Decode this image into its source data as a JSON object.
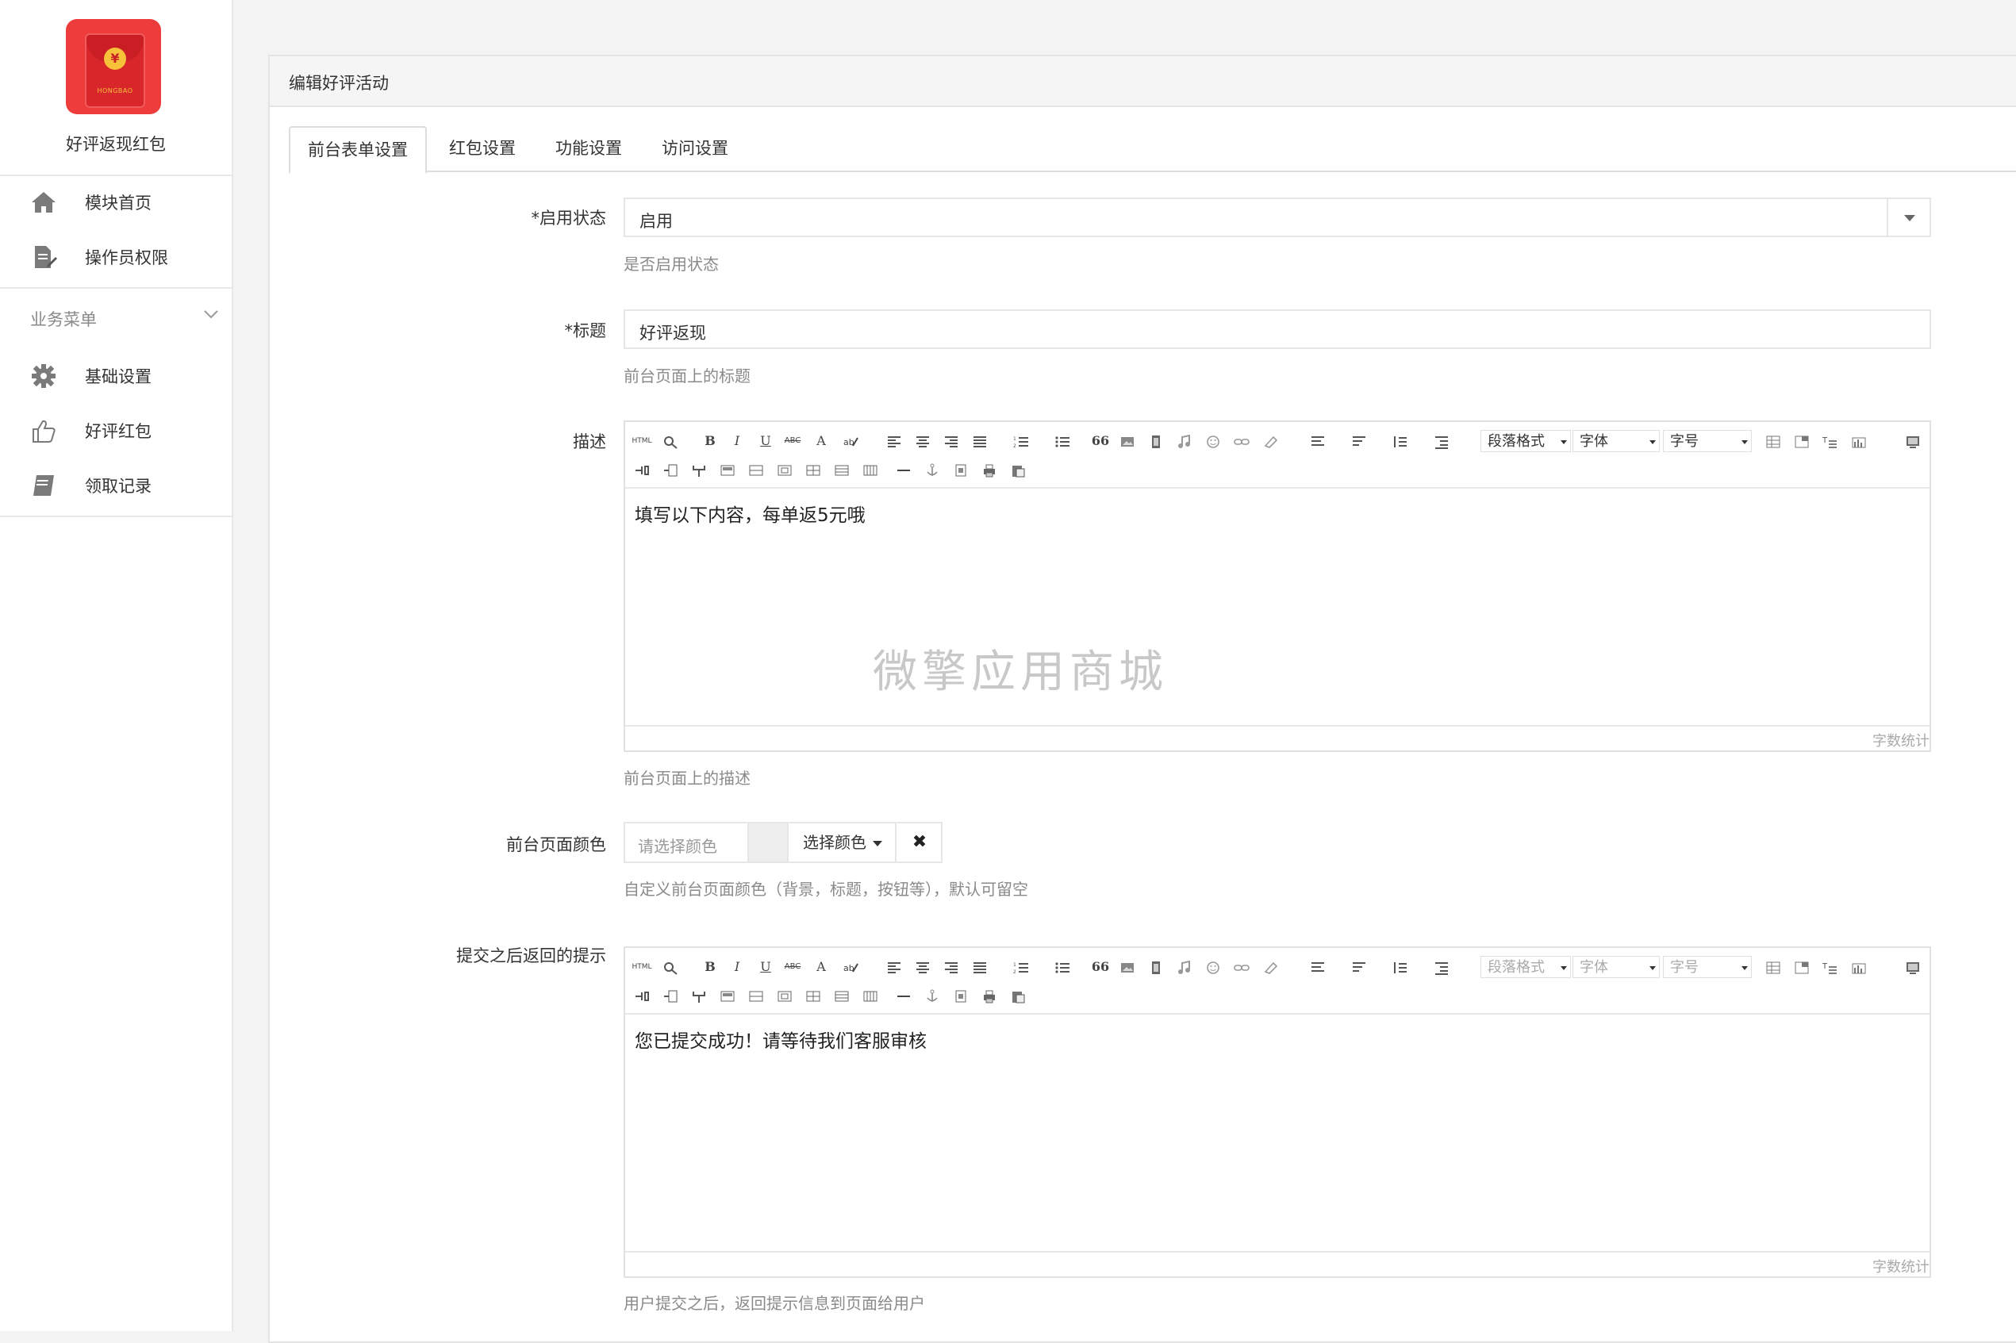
{
  "sidebar": {
    "app_name": "好评返现红包",
    "logo_text": "HONGBAO",
    "logo_symbol": "¥",
    "top_items": [
      {
        "label": "模块首页",
        "icon": "home-icon"
      },
      {
        "label": "操作员权限",
        "icon": "document-edit-icon"
      }
    ],
    "group_title": "业务菜单",
    "group_items": [
      {
        "label": "基础设置",
        "icon": "gear-icon"
      },
      {
        "label": "好评红包",
        "icon": "thumbs-up-icon"
      },
      {
        "label": "领取记录",
        "icon": "book-icon"
      }
    ]
  },
  "panel": {
    "title": "编辑好评活动",
    "tabs": [
      "前台表单设置",
      "红包设置",
      "功能设置",
      "访问设置"
    ],
    "active_tab": 0
  },
  "form": {
    "status": {
      "label": "*启用状态",
      "value": "启用",
      "help": "是否启用状态"
    },
    "title": {
      "label": "*标题",
      "value": "好评返现",
      "help": "前台页面上的标题"
    },
    "description": {
      "label": "描述",
      "content": "填写以下内容，每单返5元哦",
      "help": "前台页面上的描述",
      "word_count": "字数统计"
    },
    "color": {
      "label": "前台页面颜色",
      "placeholder": "请选择颜色",
      "button": "选择颜色",
      "clear": "✖",
      "help": "自定义前台页面颜色（背景，标题，按钮等），默认可留空"
    },
    "submit_tip": {
      "label": "提交之后返回的提示",
      "content": "您已提交成功！请等待我们客服审核",
      "help": "用户提交之后，返回提示信息到页面给用户",
      "word_count": "字数统计"
    }
  },
  "toolbar": {
    "paragraph": "段落格式",
    "font": "字体",
    "size": "字号",
    "html": "HTML",
    "bold": "B",
    "italic": "I",
    "underline": "U",
    "strike": "ABC",
    "font_color": "A",
    "quote": "66"
  },
  "watermark": "微擎应用商城",
  "colors": {
    "logo_bg": "#ee3b3b",
    "panel_header": "#f5f5f5",
    "help_text": "#8a8a8a"
  }
}
